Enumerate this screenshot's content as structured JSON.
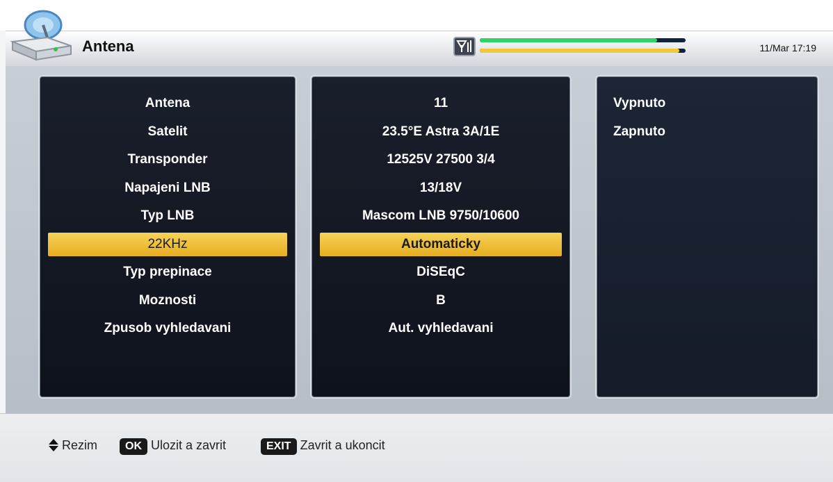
{
  "header": {
    "title": "Antena",
    "datetime": "11/Mar 17:19",
    "signal_strength": 0.86,
    "signal_quality": 0.97,
    "colors": {
      "strength": "#33d36a",
      "quality": "#f0c93b",
      "bar_bg": "#14233c"
    }
  },
  "settings": [
    {
      "label": "Antena",
      "value": "11"
    },
    {
      "label": "Satelit",
      "value": "23.5°E Astra 3A/1E"
    },
    {
      "label": "Transponder",
      "value": "12525V 27500 3/4"
    },
    {
      "label": "Napajeni LNB",
      "value": "13/18V"
    },
    {
      "label": "Typ LNB",
      "value": "Mascom LNB 9750/10600"
    },
    {
      "label": "22KHz",
      "value": "Automaticky",
      "selected": true
    },
    {
      "label": "Typ prepinace",
      "value": "DiSEqC"
    },
    {
      "label": "Moznosti",
      "value": "B"
    },
    {
      "label": "Zpusob vyhledavani",
      "value": "Aut. vyhledavani"
    }
  ],
  "options": [
    "Vypnuto",
    "Zapnuto"
  ],
  "footer": {
    "mode_label": "Rezim",
    "ok_key": "OK",
    "ok_label": "Ulozit a zavrit",
    "exit_key": "EXIT",
    "exit_label": "Zavrit a ukoncit"
  },
  "highlight_color": "#f0c33a"
}
